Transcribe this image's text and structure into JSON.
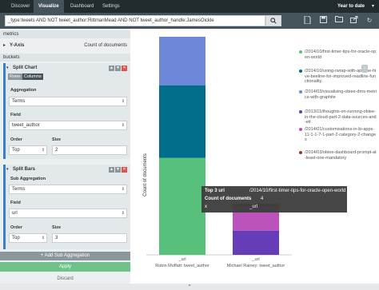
{
  "nav": {
    "items": [
      "Discover",
      "Visualize",
      "Dashboard",
      "Settings"
    ],
    "active": "Visualize",
    "time_range": "Year to date"
  },
  "search": {
    "query": "_type:tweets AND NOT tweet_author:RittmanMead AND NOT tweet_author_handle:JamesOickle"
  },
  "sidebar": {
    "metrics_header": "metrics",
    "y_axis_label": "Y-Axis",
    "y_axis_value": "Count of documents",
    "buckets_header": "buckets",
    "split_chart": {
      "title": "Split Chart",
      "tab_rows": "Rows",
      "tab_columns": "Columns",
      "aggregation_label": "Aggregation",
      "aggregation_value": "Terms",
      "field_label": "Field",
      "field_value": "tweet_author",
      "order_label": "Order",
      "order_value": "Top",
      "size_label": "Size",
      "size_value": "2"
    },
    "split_bars": {
      "title": "Split Bars",
      "sub_aggregation_label": "Sub Aggregation",
      "sub_aggregation_value": "Terms",
      "field_label": "Field",
      "field_value": "url",
      "order_label": "Order",
      "order_value": "Top",
      "size_label": "Size",
      "size_value": "3"
    },
    "add_sub_aggregation": "Add Sub Aggregation",
    "apply": "Apply",
    "discard": "Discard"
  },
  "chart_data": {
    "type": "bar",
    "stacked": true,
    "ylabel": "Count of documents",
    "categories": [
      "Robin Moffatt: tweet_author",
      "Michael Rainey: tweet_author"
    ],
    "bar_tick_labels": [
      "_url",
      "_url"
    ],
    "series": [
      {
        "name": "/2014/10/first-timer-tips-for-oracle-open-world",
        "color": "#57c17b",
        "values": [
          4,
          0
        ]
      },
      {
        "name": "/2014/10/using-rwrap-with-apache-hive-beeline-for-improved-readline-functionality",
        "color": "#006e8a",
        "values": [
          3,
          0
        ]
      },
      {
        "name": "/2014/03/visualising-obiee-dms-metrics-with-graphite",
        "color": "#6f87d8",
        "values": [
          2,
          0
        ]
      },
      {
        "name": "/2013/11/thoughts-on-running-obiee-in-the-cloud-part-2-data-sources-and-etl",
        "color": "#663db8",
        "values": [
          0,
          1
        ]
      },
      {
        "name": "/2014/01/customisations-in-bi-apps-11-1-1-7-1-part-2-category-2-changes",
        "color": "#bc52bc",
        "values": [
          0,
          1
        ]
      },
      {
        "name": "/2014/03/obiee-dashboard-prompt-at-least-one-mandatory",
        "color": "#9e3533",
        "values": [
          0,
          0.1
        ]
      }
    ],
    "legend_position": "right",
    "grid": false
  },
  "tooltip": {
    "label_1": "Top 3 url",
    "value_1": "/2014/10/first-timer-tips-for-oracle-open-world",
    "label_2": "Count of documents",
    "value_2": "4",
    "label_3": "x",
    "value_3": "_url"
  },
  "footer": {
    "caret": "^"
  }
}
